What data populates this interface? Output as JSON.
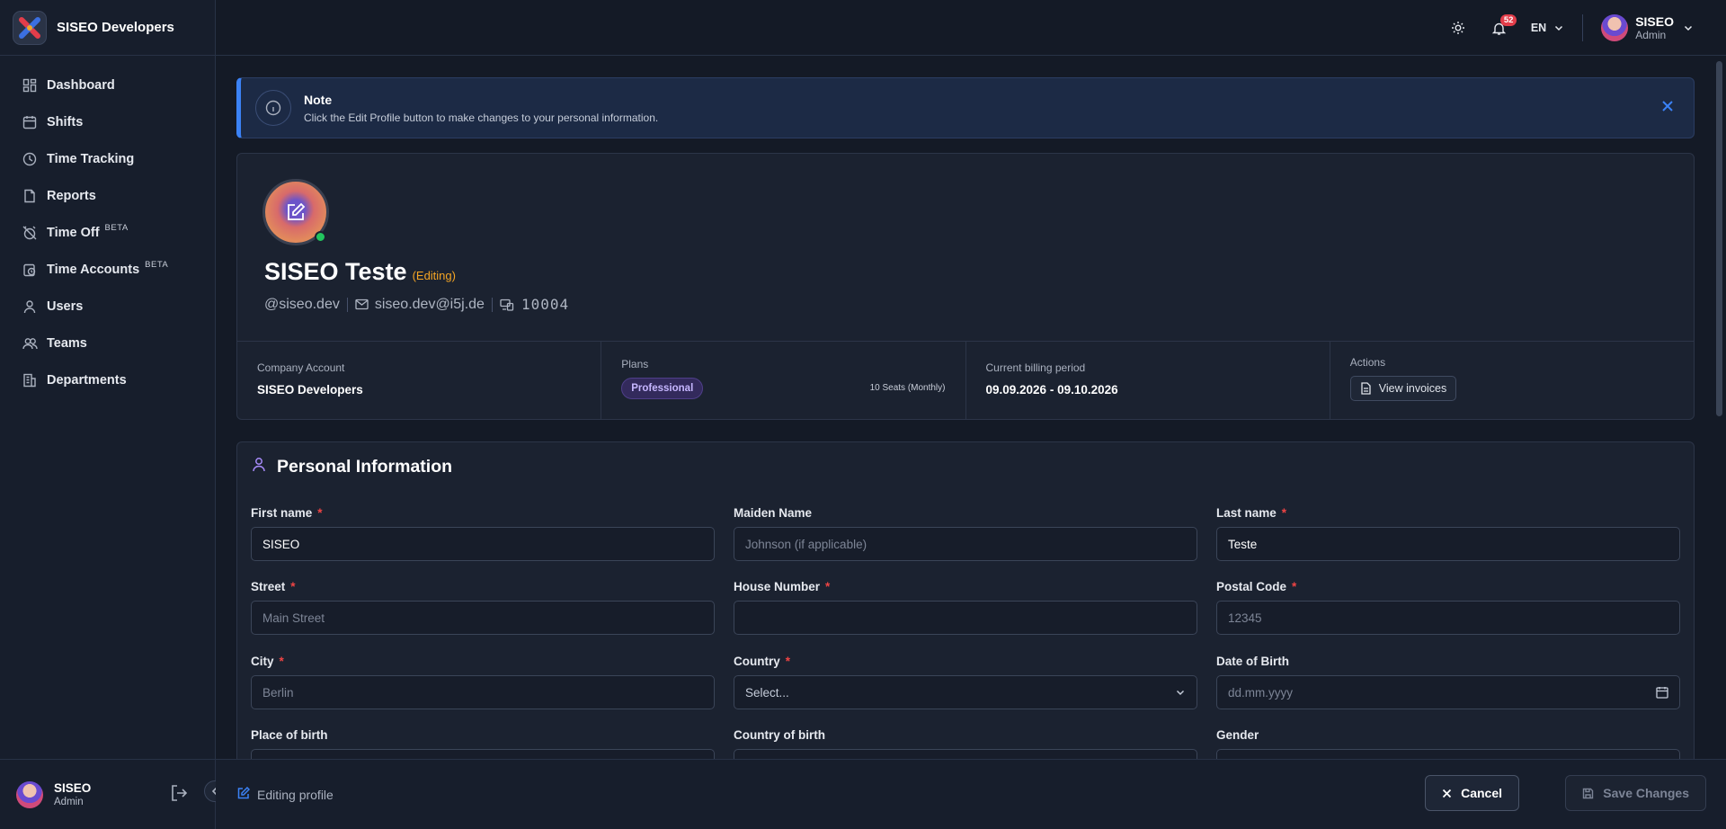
{
  "brand": {
    "name": "SISEO Developers"
  },
  "sidebar": {
    "items": [
      {
        "label": "Dashboard",
        "icon": "dashboard-icon",
        "beta": ""
      },
      {
        "label": "Shifts",
        "icon": "calendar-icon",
        "beta": ""
      },
      {
        "label": "Time Tracking",
        "icon": "clock-icon",
        "beta": ""
      },
      {
        "label": "Reports",
        "icon": "report-icon",
        "beta": ""
      },
      {
        "label": "Time Off",
        "icon": "alarm-off-icon",
        "beta": "BETA"
      },
      {
        "label": "Time Accounts",
        "icon": "clock-account-icon",
        "beta": "BETA"
      },
      {
        "label": "Users",
        "icon": "user-icon",
        "beta": ""
      },
      {
        "label": "Teams",
        "icon": "users-icon",
        "beta": ""
      },
      {
        "label": "Departments",
        "icon": "building-icon",
        "beta": ""
      }
    ],
    "footer": {
      "name": "SISEO",
      "role": "Admin"
    }
  },
  "header": {
    "notifications_count": "52",
    "language": "EN",
    "user": {
      "name": "SISEO",
      "role": "Admin"
    }
  },
  "note": {
    "title": "Note",
    "text": "Click the Edit Profile button to make changes to your personal information."
  },
  "profile": {
    "name": "SISEO Teste",
    "status": "(Editing)",
    "username": "@siseo.dev",
    "email": "siseo.dev@i5j.de",
    "employee_id": "10004",
    "company_label": "Company Account",
    "company_value": "SISEO Developers",
    "plans_label": "Plans",
    "plan_value": "Professional",
    "seats": "10 Seats (Monthly)",
    "billing_label": "Current billing period",
    "billing_value": "09.09.2026 - 09.10.2026",
    "actions_label": "Actions",
    "invoices_button": "View invoices"
  },
  "personal_info": {
    "title": "Personal Information",
    "fields": {
      "first_name": {
        "label": "First name",
        "value": "SISEO",
        "placeholder": ""
      },
      "maiden_name": {
        "label": "Maiden Name",
        "value": "",
        "placeholder": "Johnson (if applicable)"
      },
      "last_name": {
        "label": "Last name",
        "value": "Teste",
        "placeholder": ""
      },
      "street": {
        "label": "Street",
        "value": "",
        "placeholder": "Main Street"
      },
      "house_number": {
        "label": "House Number",
        "value": "",
        "placeholder": ""
      },
      "postal_code": {
        "label": "Postal Code",
        "value": "",
        "placeholder": "12345"
      },
      "city": {
        "label": "City",
        "value": "",
        "placeholder": "Berlin"
      },
      "country": {
        "label": "Country",
        "value": "",
        "placeholder": "Select..."
      },
      "date_of_birth": {
        "label": "Date of Birth",
        "value": "",
        "placeholder": "dd.mm.yyyy"
      },
      "place_of_birth": {
        "label": "Place of birth"
      },
      "country_of_birth": {
        "label": "Country of birth"
      },
      "gender": {
        "label": "Gender"
      }
    },
    "required_marker": "*"
  },
  "bottombar": {
    "status": "Editing profile",
    "cancel": "Cancel",
    "save": "Save Changes"
  },
  "colors": {
    "accent": "#3b82f6",
    "required": "#ef4444",
    "editing": "#f5a524",
    "online": "#22c55e",
    "plan": "#c6b6ff"
  }
}
